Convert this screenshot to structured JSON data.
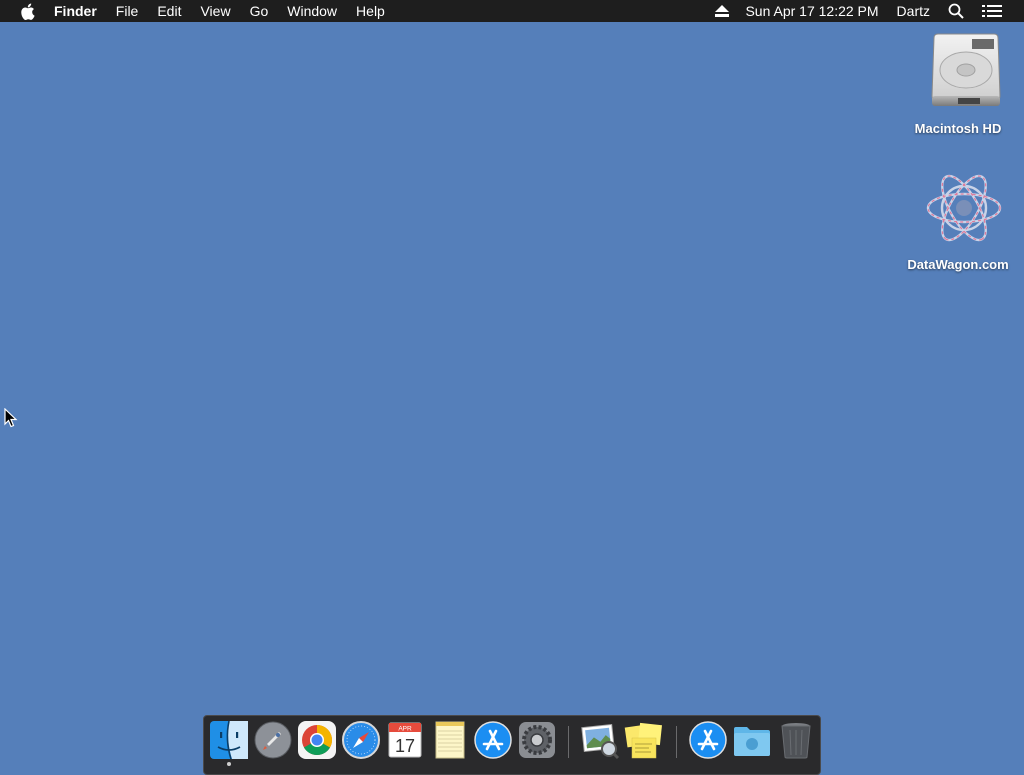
{
  "menubar": {
    "apple_icon": "apple-icon",
    "app_name": "Finder",
    "menus": [
      "File",
      "Edit",
      "View",
      "Go",
      "Window",
      "Help"
    ],
    "eject_icon": "eject-icon",
    "datetime": "Sun Apr 17  12:22 PM",
    "user": "Dartz",
    "search_icon": "spotlight-icon",
    "notification_icon": "notification-center-icon"
  },
  "desktop": {
    "icons": [
      {
        "label": "Macintosh HD",
        "icon": "hard-drive-icon"
      },
      {
        "label": "DataWagon.com",
        "icon": "network-volume-icon"
      }
    ]
  },
  "dock": {
    "items": [
      {
        "name": "Finder",
        "icon": "finder-icon",
        "running": true
      },
      {
        "name": "Launchpad",
        "icon": "launchpad-icon"
      },
      {
        "name": "Google Chrome",
        "icon": "chrome-icon"
      },
      {
        "name": "Safari",
        "icon": "safari-icon"
      },
      {
        "name": "Calendar",
        "icon": "calendar-icon",
        "month": "APR",
        "day": "17"
      },
      {
        "name": "Notes",
        "icon": "notes-icon"
      },
      {
        "name": "App Store",
        "icon": "app-store-icon"
      },
      {
        "name": "System Preferences",
        "icon": "system-preferences-icon"
      },
      {
        "name": "Preview",
        "icon": "preview-icon"
      },
      {
        "name": "Stickies",
        "icon": "stickies-icon"
      },
      {
        "name": "App Store",
        "icon": "app-store-icon"
      },
      {
        "name": "Downloads",
        "icon": "downloads-folder-icon"
      },
      {
        "name": "Trash",
        "icon": "trash-icon"
      }
    ]
  },
  "colors": {
    "desktop": "#557fba",
    "menubar": "#1e1e1e",
    "dock": "#2a2a2c"
  }
}
